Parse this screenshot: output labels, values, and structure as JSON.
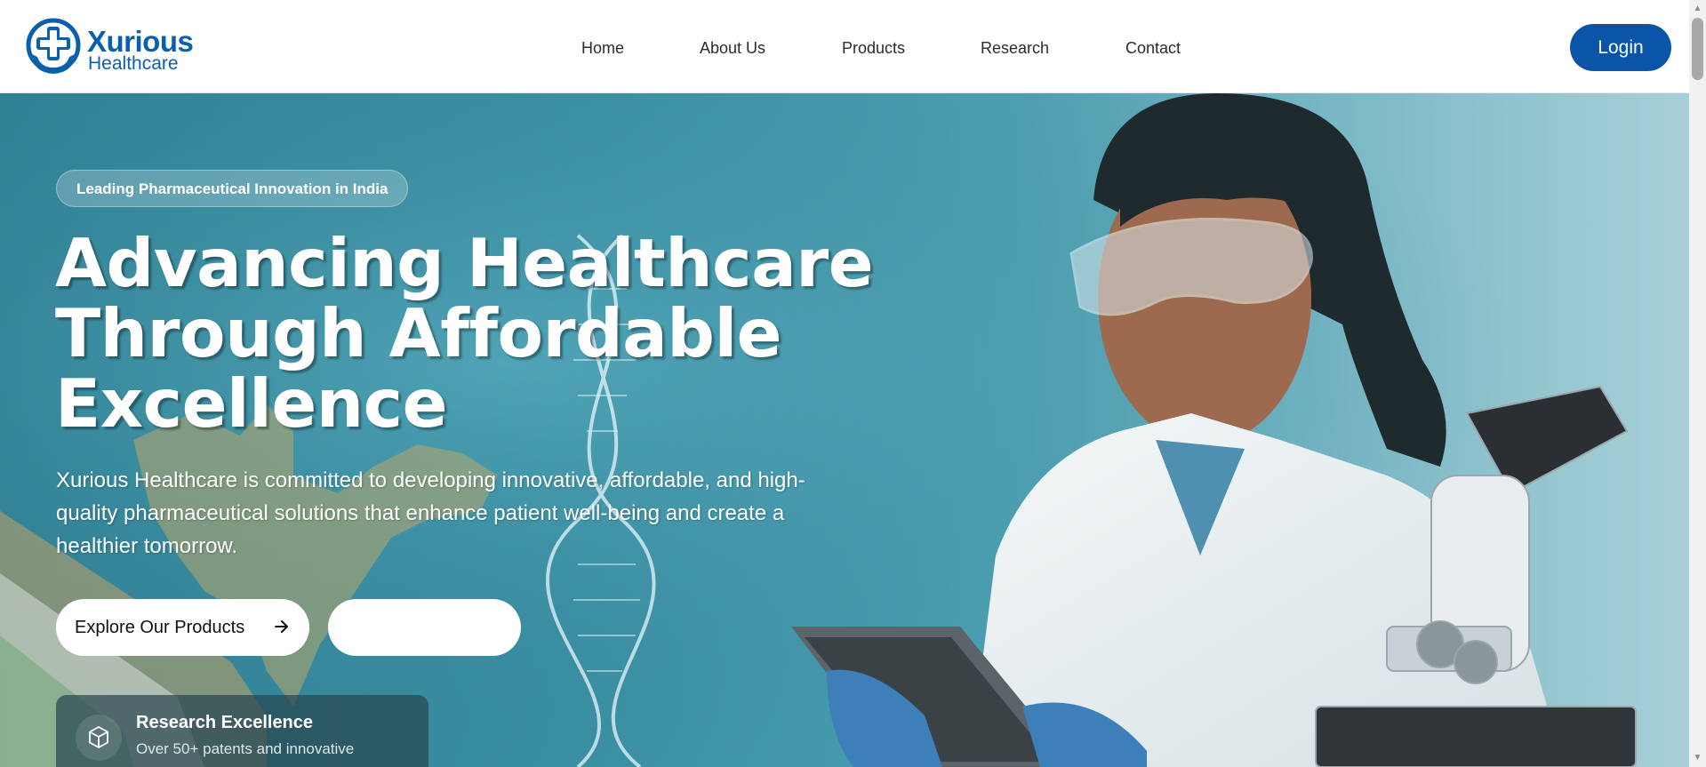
{
  "brand": {
    "name": "Xurious",
    "subtitle": "Healthcare",
    "color": "#0b5fad"
  },
  "nav": {
    "items": [
      "Home",
      "About Us",
      "Products",
      "Research",
      "Contact"
    ]
  },
  "header": {
    "login_label": "Login",
    "login_color": "#0b55a8"
  },
  "hero": {
    "badge": "Leading Pharmaceutical Innovation in India",
    "title_lines": [
      "Advancing Healthcare",
      "Through Affordable",
      "Excellence"
    ],
    "description": "Xurious Healthcare is committed to developing innovative, affordable, and high-quality pharmaceutical solutions that enhance patient well-being and create a healthier tomorrow.",
    "primary_button": "Explore Our Products",
    "primary_icon": "arrow-right-icon",
    "secondary_button": ""
  },
  "feature": {
    "icon": "cube-icon",
    "title": "Research Excellence",
    "description": "Over 50+ patents and innovative"
  }
}
